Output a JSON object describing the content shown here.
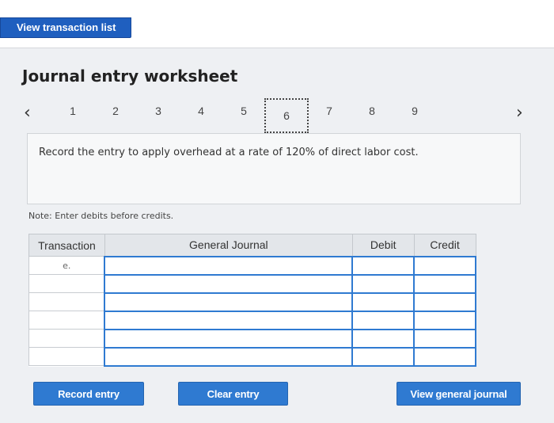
{
  "header": {
    "view_list_label": "View transaction list"
  },
  "worksheet": {
    "title": "Journal entry worksheet",
    "pager": {
      "prev_icon": "chevron-left-icon",
      "next_icon": "chevron-right-icon",
      "pages": [
        "1",
        "2",
        "3",
        "4",
        "5",
        "6",
        "7",
        "8",
        "9"
      ],
      "active": "6"
    },
    "instruction": "Record the entry to apply overhead at a rate of 120% of direct labor cost.",
    "note": "Note: Enter debits before credits.",
    "table": {
      "headers": {
        "transaction": "Transaction",
        "general_journal": "General Journal",
        "debit": "Debit",
        "credit": "Credit"
      },
      "rows": [
        {
          "transaction": "e.",
          "account": "",
          "debit": "",
          "credit": ""
        },
        {
          "transaction": "",
          "account": "",
          "debit": "",
          "credit": ""
        },
        {
          "transaction": "",
          "account": "",
          "debit": "",
          "credit": ""
        },
        {
          "transaction": "",
          "account": "",
          "debit": "",
          "credit": ""
        },
        {
          "transaction": "",
          "account": "",
          "debit": "",
          "credit": ""
        },
        {
          "transaction": "",
          "account": "",
          "debit": "",
          "credit": ""
        }
      ]
    },
    "buttons": {
      "record": "Record entry",
      "clear": "Clear entry",
      "view_journal": "View general journal"
    }
  },
  "colors": {
    "accent": "#2f7ad1",
    "panel": "#eef0f3"
  }
}
